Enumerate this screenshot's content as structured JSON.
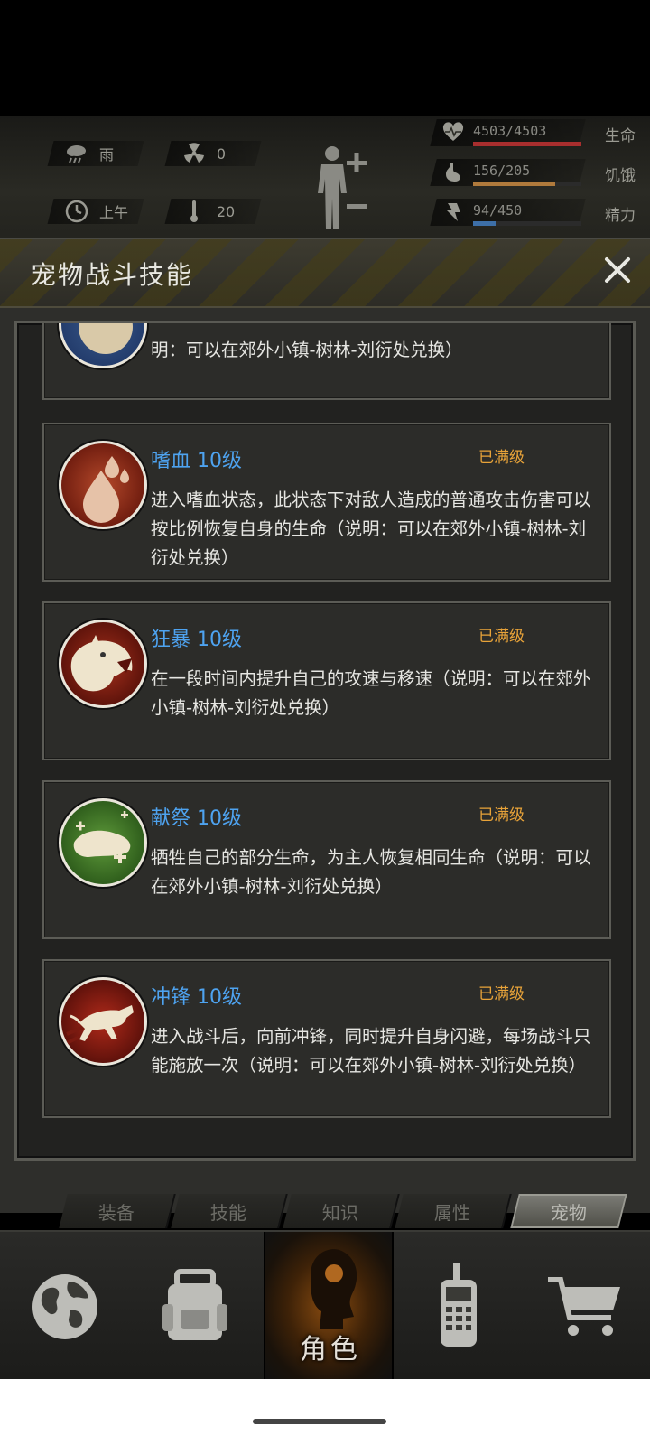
{
  "hud": {
    "weather": "雨",
    "radiation": "0",
    "time_of_day": "上午",
    "temperature": "20",
    "stats": [
      {
        "value": "4503/4503",
        "label": "生命",
        "fill": 1.0,
        "color": "#a82e2e",
        "icon": "heart-icon"
      },
      {
        "value": "156/205",
        "label": "饥饿",
        "fill": 0.76,
        "color": "#b07a3c",
        "icon": "stomach-icon"
      },
      {
        "value": "94/450",
        "label": "精力",
        "fill": 0.21,
        "color": "#3d6fa8",
        "icon": "energy-icon"
      }
    ]
  },
  "dialog": {
    "title": "宠物战斗技能",
    "close_icon": "close-icon"
  },
  "skills": [
    {
      "name": "",
      "max": "",
      "desc": "明：可以在郊外小镇-树林-刘衍处兑换）",
      "icon": "partial-skill-icon"
    },
    {
      "name": "嗜血 10级",
      "max": "已满级",
      "desc": "进入嗜血状态，此状态下对敌人造成的普通攻击伤害可以按比例恢复自身的生命（说明：可以在郊外小镇-树林-刘衍处兑换）",
      "icon": "blood-drop-icon"
    },
    {
      "name": "狂暴 10级",
      "max": "已满级",
      "desc": "在一段时间内提升自己的攻速与移速（说明：可以在郊外小镇-树林-刘衍处兑换）",
      "icon": "roaring-beast-icon"
    },
    {
      "name": "献祭 10级",
      "max": "已满级",
      "desc": "牺牲自己的部分生命，为主人恢复相同生命（说明：可以在郊外小镇-树林-刘衍处兑换）",
      "icon": "healing-paw-icon"
    },
    {
      "name": "冲锋 10级",
      "max": "已满级",
      "desc": "进入战斗后，向前冲锋，同时提升自身闪避，每场战斗只能施放一次（说明：可以在郊外小镇-树林-刘衍处兑换）",
      "icon": "charging-dog-icon"
    }
  ],
  "tabs": [
    "装备",
    "技能",
    "知识",
    "属性",
    "宠物"
  ],
  "active_tab": "宠物",
  "nav": {
    "active_label": "角色",
    "items": [
      "globe-icon",
      "backpack-icon",
      "character-icon",
      "radio-icon",
      "cart-icon"
    ]
  }
}
